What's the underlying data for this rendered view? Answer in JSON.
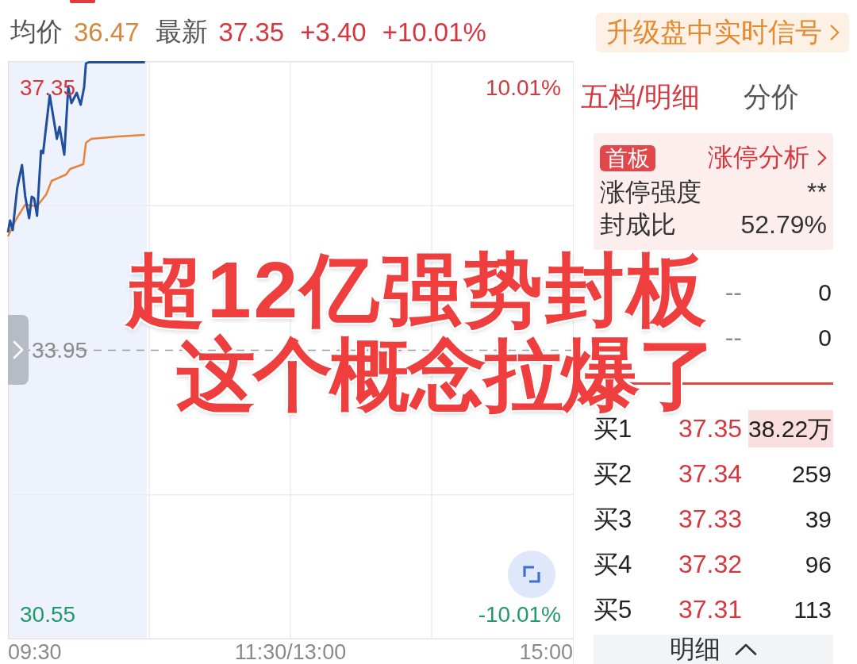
{
  "quote_bar": {
    "average_label": "均价",
    "average": "36.47",
    "latest_label": "最新",
    "latest": "37.35",
    "change": "+3.40",
    "change_percent": "+10.01%"
  },
  "upgrade_button": {
    "label": "升级盘中实时信号"
  },
  "quote_chart": {
    "price_labels": [
      {
        "text": "37.35",
        "kind": "up"
      },
      {
        "text": "33.95",
        "kind": "flat"
      },
      {
        "text": "30.55",
        "kind": "down"
      }
    ],
    "percent_labels": [
      {
        "text": "10.01%",
        "kind": "up"
      },
      {
        "text": "-10.01%",
        "kind": "down"
      }
    ],
    "time_labels": [
      "09:30",
      "11:30/13:00",
      "15:00"
    ]
  },
  "order_book": {
    "tabs": [
      {
        "label": "五档/明细",
        "selected": true
      },
      {
        "label": "分价",
        "selected": false
      }
    ],
    "limit_card": {
      "badge": "首板",
      "link": "涨停分析",
      "rows": [
        {
          "label": "涨停强度",
          "value": "**"
        },
        {
          "label": "封成比",
          "value": "52.79%"
        }
      ]
    },
    "asks": [
      {
        "price": "--",
        "volume": "0",
        "highlighted": false
      },
      {
        "price": "--",
        "volume": "0",
        "highlighted": false
      }
    ],
    "bids": [
      {
        "label": "买1",
        "price": "37.35",
        "volume": "38.22万",
        "highlighted": true
      },
      {
        "label": "买2",
        "price": "37.34",
        "volume": "259",
        "highlighted": false
      },
      {
        "label": "买3",
        "price": "37.33",
        "volume": "39",
        "highlighted": false
      },
      {
        "label": "买4",
        "price": "37.32",
        "volume": "96",
        "highlighted": false
      },
      {
        "label": "买5",
        "price": "37.31",
        "volume": "113",
        "highlighted": false
      }
    ],
    "detail_button": {
      "label": "明细"
    }
  },
  "headline": {
    "lines": [
      "超12亿强势封板",
      "这个概念拉爆了"
    ]
  }
}
